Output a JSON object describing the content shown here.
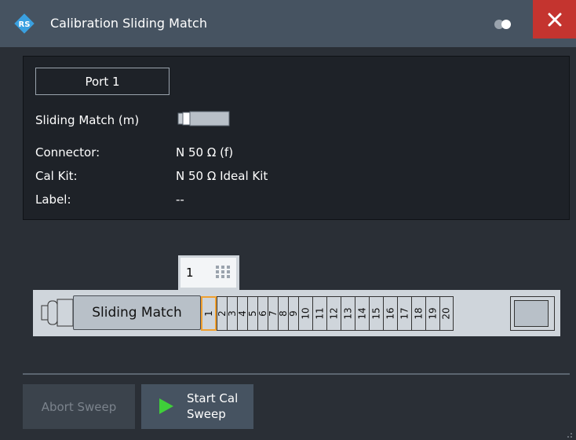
{
  "window": {
    "title": "Calibration Sliding Match",
    "close_icon": "close-icon",
    "logo_icon": "rs-logo-icon"
  },
  "info": {
    "port": "Port 1",
    "rows": [
      {
        "label": "Sliding Match (m)",
        "value": ""
      },
      {
        "label": "Connector:",
        "value": "N 50 Ω (f)"
      },
      {
        "label": "Cal Kit:",
        "value": "N 50 Ω Ideal Kit"
      },
      {
        "label": "Label:",
        "value": "--"
      }
    ]
  },
  "stepper": {
    "value": "1",
    "keypad_icon": "keypad-icon"
  },
  "slider": {
    "label": "Sliding Match",
    "positions": [
      "1",
      "2",
      "3",
      "4",
      "5",
      "6",
      "7",
      "8",
      "9",
      "10",
      "11",
      "12",
      "13",
      "14",
      "15",
      "16",
      "17",
      "18",
      "19",
      "20"
    ],
    "selected": "1"
  },
  "buttons": {
    "abort": "Abort Sweep",
    "start_line1": "Start Cal",
    "start_line2": "Sweep"
  },
  "colors": {
    "titlebar": "#465361",
    "close": "#c4342f",
    "accent": "#f0a030",
    "play": "#3fcf3a"
  }
}
